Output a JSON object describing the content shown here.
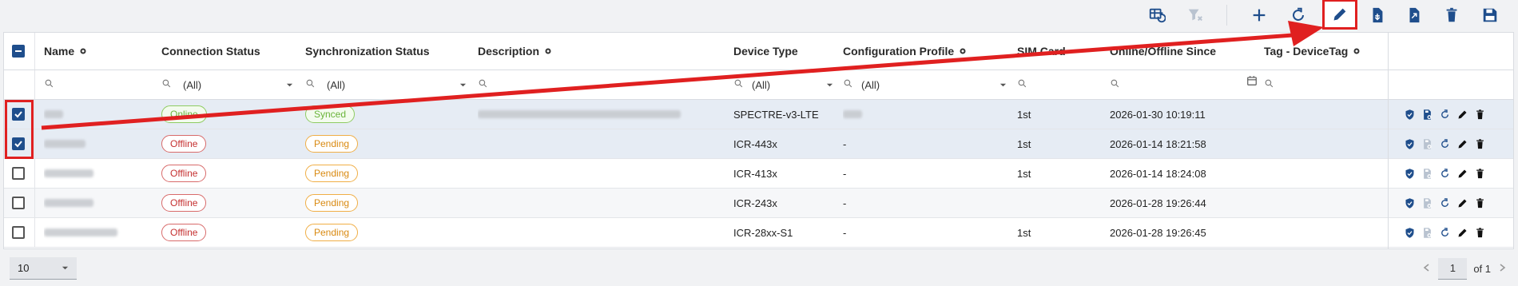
{
  "columns": {
    "name": "Name",
    "connection": "Connection Status",
    "sync": "Synchronization Status",
    "description": "Description",
    "device_type": "Device Type",
    "config_profile": "Configuration Profile",
    "sim": "SIM Card",
    "since": "Online/Offline Since",
    "tag": "Tag - DeviceTag"
  },
  "filters": {
    "connection": "(All)",
    "sync": "(All)",
    "device_type": "(All)",
    "config_profile": "(All)"
  },
  "rows": [
    {
      "selected": true,
      "connection": "Online",
      "sync": "Synced",
      "device_type": "SPECTRE-v3-LTE",
      "config_profile": "",
      "sim": "1st",
      "since": "2026-01-30 10:19:11"
    },
    {
      "selected": true,
      "connection": "Offline",
      "sync": "Pending",
      "device_type": "ICR-443x",
      "config_profile": "-",
      "sim": "1st",
      "since": "2026-01-14 18:21:58"
    },
    {
      "selected": false,
      "connection": "Offline",
      "sync": "Pending",
      "device_type": "ICR-413x",
      "config_profile": "-",
      "sim": "1st",
      "since": "2026-01-14 18:24:08"
    },
    {
      "selected": false,
      "connection": "Offline",
      "sync": "Pending",
      "device_type": "ICR-243x",
      "config_profile": "-",
      "sim": "",
      "since": "2026-01-28 19:26:44"
    },
    {
      "selected": false,
      "connection": "Offline",
      "sync": "Pending",
      "device_type": "ICR-28xx-S1",
      "config_profile": "-",
      "sim": "1st",
      "since": "2026-01-28 19:26:45"
    }
  ],
  "pagination": {
    "page_size": "10",
    "page": "1",
    "of_label": "of 1"
  },
  "colors": {
    "accent": "#1f4e8c",
    "highlight": "#e02020",
    "online": "#6ab43a",
    "offline": "#c53030",
    "pending": "#d98a12"
  },
  "icons": {
    "toolbar": [
      "table-refresh-icon",
      "clear-filter-icon",
      "add-icon",
      "refresh-icon",
      "edit-icon",
      "import-icon",
      "export-icon",
      "delete-icon",
      "save-icon"
    ],
    "row_actions": [
      "shield-icon",
      "config-upload-icon",
      "restart-icon",
      "edit-icon",
      "delete-icon"
    ]
  }
}
